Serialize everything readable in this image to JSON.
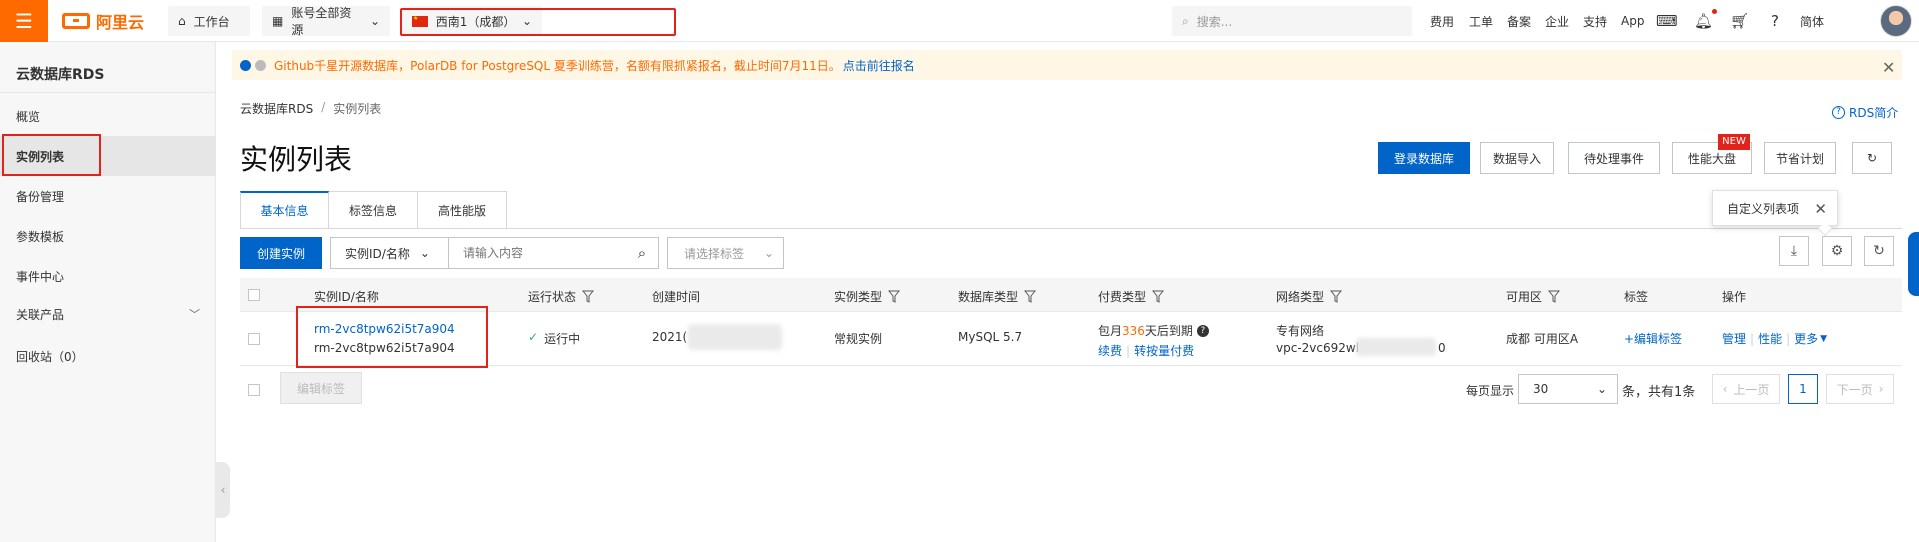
{
  "topbar": {
    "brand": "阿里云",
    "workbench": "工作台",
    "resources": "账号全部资源",
    "region": "西南1（成都）",
    "search_placeholder": "搜索...",
    "links": [
      "费用",
      "工单",
      "备案",
      "企业",
      "支持",
      "App"
    ],
    "lang": "简体",
    "accent": "#ff6a00"
  },
  "sidebar": {
    "title": "云数据库RDS",
    "items": [
      {
        "label": "概览"
      },
      {
        "label": "实例列表",
        "active": true
      },
      {
        "label": "备份管理"
      },
      {
        "label": "参数模板"
      },
      {
        "label": "事件中心"
      },
      {
        "label": "关联产品"
      },
      {
        "label": "回收站（0）"
      }
    ]
  },
  "notice": {
    "text": "Github千星开源数据库，PolarDB for PostgreSQL 夏季训练营，名额有限抓紧报名，截止时间7月11日。",
    "link": "点击前往报名"
  },
  "breadcrumb": {
    "root": "云数据库RDS",
    "sep": "/",
    "current": "实例列表"
  },
  "rds_intro": "RDS简介",
  "page_title": "实例列表",
  "actions": {
    "login": "登录数据库",
    "import": "数据导入",
    "pending": "待处理事件",
    "perf": "性能大盘",
    "new_badge": "NEW",
    "save": "节省计划"
  },
  "tabs": [
    "基本信息",
    "标签信息",
    "高性能版"
  ],
  "tooltip": "自定义列表项",
  "toolbar": {
    "create": "创建实例",
    "filter_select": "实例ID/名称",
    "filter_placeholder": "请输入内容",
    "tag_placeholder": "请选择标签"
  },
  "table": {
    "headers": [
      "实例ID/名称",
      "运行状态",
      "创建时间",
      "实例类型",
      "数据库类型",
      "付费类型",
      "网络类型",
      "可用区",
      "标签",
      "操作"
    ],
    "row": {
      "id": "rm-2vc8tpw62i5t7a904",
      "name": "rm-2vc8tpw62i5t7a904",
      "status": "运行中",
      "created": "2021(",
      "instance_type": "常规实例",
      "db_type": "MySQL 5.7",
      "pay_prefix": "包月",
      "pay_days": "336",
      "pay_suffix": "天后到期",
      "renew": "续费",
      "to_payg": "转按量付费",
      "net_type": "专有网络",
      "vpc_prefix": "vpc-2vc692wl",
      "vpc_suffix": "0",
      "zone": "成都 可用区A",
      "edit_tag": "+编辑标签",
      "manage": "管理",
      "perf": "性能",
      "more": "更多"
    }
  },
  "footer": {
    "edit_tag": "编辑标签",
    "per_page_label": "每页显示",
    "page_size": "30",
    "total": "条，共有1条",
    "prev": "上一页",
    "page": "1",
    "next": "下一页"
  }
}
